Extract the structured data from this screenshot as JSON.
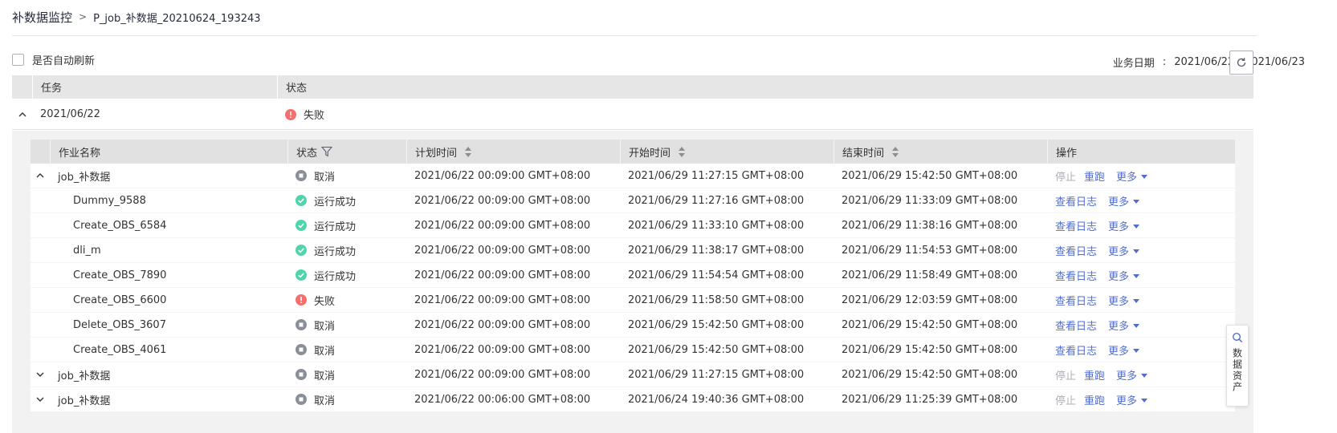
{
  "breadcrumb": {
    "root": "补数据监控",
    "separator": ">",
    "current": "P_job_补数据_20210624_193243"
  },
  "auto_refresh": {
    "label": "是否自动刷新",
    "checked": false
  },
  "business_date": {
    "label": "业务日期",
    "colon": ":",
    "value": "2021/06/22 - 2021/06/23"
  },
  "outer_table": {
    "headers": {
      "task": "任务",
      "status": "状态"
    },
    "row": {
      "date": "2021/06/22",
      "status": "失败"
    }
  },
  "inner_table": {
    "headers": {
      "name": "作业名称",
      "status": "状态",
      "plan_time": "计划时间",
      "start_time": "开始时间",
      "end_time": "结束时间",
      "ops": "操作"
    },
    "rows": [
      {
        "name": "job_补数据",
        "status": "取消",
        "plan": "2021/06/22 00:09:00 GMT+08:00",
        "start": "2021/06/29 11:27:15 GMT+08:00",
        "end": "2021/06/29 15:42:50 GMT+08:00",
        "op1": "停止",
        "op2": "重跑",
        "op3": "更多"
      },
      {
        "name": "Dummy_9588",
        "status": "运行成功",
        "plan": "2021/06/22 00:09:00 GMT+08:00",
        "start": "2021/06/29 11:27:16 GMT+08:00",
        "end": "2021/06/29 11:33:09 GMT+08:00",
        "op1": "查看日志",
        "op3": "更多"
      },
      {
        "name": "Create_OBS_6584",
        "status": "运行成功",
        "plan": "2021/06/22 00:09:00 GMT+08:00",
        "start": "2021/06/29 11:33:10 GMT+08:00",
        "end": "2021/06/29 11:38:16 GMT+08:00",
        "op1": "查看日志",
        "op3": "更多"
      },
      {
        "name": "dli_m",
        "status": "运行成功",
        "plan": "2021/06/22 00:09:00 GMT+08:00",
        "start": "2021/06/29 11:38:17 GMT+08:00",
        "end": "2021/06/29 11:54:53 GMT+08:00",
        "op1": "查看日志",
        "op3": "更多"
      },
      {
        "name": "Create_OBS_7890",
        "status": "运行成功",
        "plan": "2021/06/22 00:09:00 GMT+08:00",
        "start": "2021/06/29 11:54:54 GMT+08:00",
        "end": "2021/06/29 11:58:49 GMT+08:00",
        "op1": "查看日志",
        "op3": "更多"
      },
      {
        "name": "Create_OBS_6600",
        "status": "失败",
        "plan": "2021/06/22 00:09:00 GMT+08:00",
        "start": "2021/06/29 11:58:50 GMT+08:00",
        "end": "2021/06/29 12:03:59 GMT+08:00",
        "op1": "查看日志",
        "op3": "更多"
      },
      {
        "name": "Delete_OBS_3607",
        "status": "取消",
        "plan": "2021/06/22 00:09:00 GMT+08:00",
        "start": "2021/06/29 15:42:50 GMT+08:00",
        "end": "2021/06/29 15:42:50 GMT+08:00",
        "op1": "查看日志",
        "op3": "更多"
      },
      {
        "name": "Create_OBS_4061",
        "status": "取消",
        "plan": "2021/06/22 00:09:00 GMT+08:00",
        "start": "2021/06/29 15:42:50 GMT+08:00",
        "end": "2021/06/29 15:42:50 GMT+08:00",
        "op1": "查看日志",
        "op3": "更多"
      },
      {
        "name": "job_补数据",
        "status": "取消",
        "plan": "2021/06/22 00:09:00 GMT+08:00",
        "start": "2021/06/29 11:27:15 GMT+08:00",
        "end": "2021/06/29 15:42:50 GMT+08:00",
        "op1": "停止",
        "op2": "重跑",
        "op3": "更多"
      },
      {
        "name": "job_补数据",
        "status": "取消",
        "plan": "2021/06/22 00:06:00 GMT+08:00",
        "start": "2021/06/24 19:40:36 GMT+08:00",
        "end": "2021/06/29 11:25:39 GMT+08:00",
        "op1": "停止",
        "op2": "重跑",
        "op3": "更多"
      }
    ]
  },
  "float_tab": {
    "label": "数据资产",
    "icon": "search-icon"
  },
  "colors": {
    "link": "#526ecc",
    "success": "#50d4ab",
    "fail": "#f66f6a",
    "cancel": "#8a8e99",
    "disabled": "#adb0b8"
  }
}
